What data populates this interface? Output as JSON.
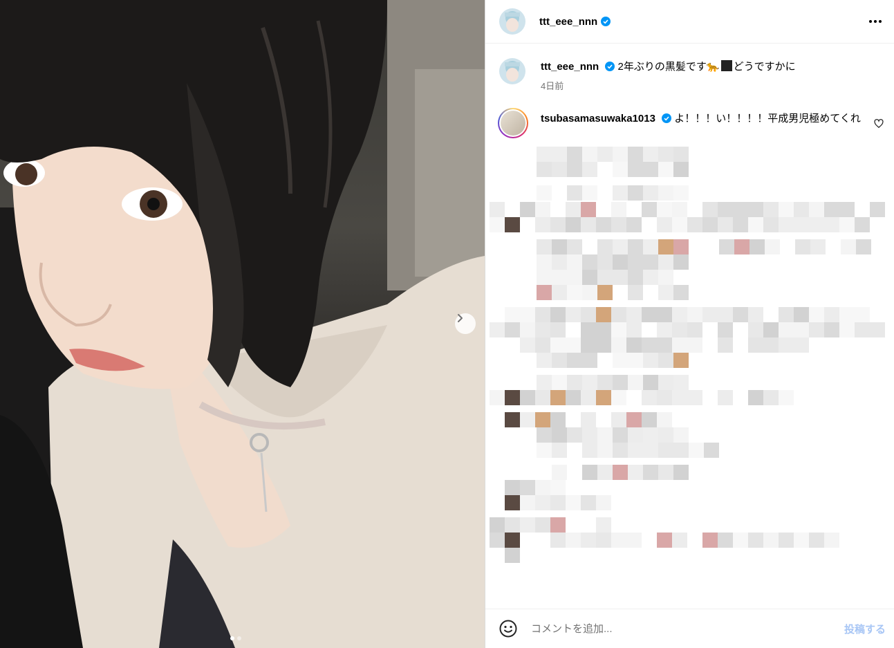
{
  "header": {
    "username": "ttt_eee_nnn"
  },
  "caption": {
    "username": "ttt_eee_nnn",
    "text_before": "2年ぶりの黒髪です",
    "emoji_cat": "🐆",
    "text_after": "どうですかに",
    "timestamp": "4日前"
  },
  "comment": {
    "username": "tsubasamasuwaka1013",
    "text": "よ！！！い！！！！平成男児極めてくれ"
  },
  "footer": {
    "placeholder": "コメントを追加...",
    "post_label": "投稿する"
  },
  "carousel": {
    "current": 1,
    "total": 2
  },
  "colors": {
    "verified": "#0095f6",
    "post_disabled": "#a8c6f5",
    "secondary_text": "#737373"
  },
  "icons": [
    "verified-badge-icon",
    "more-options-icon",
    "heart-icon",
    "emoji-icon",
    "chevron-right-icon"
  ]
}
